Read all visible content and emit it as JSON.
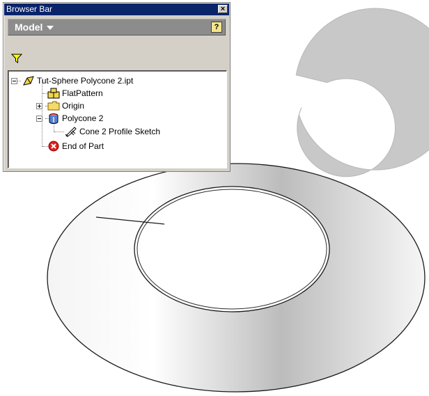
{
  "browser_bar": {
    "title": "Browser Bar",
    "close_glyph": "×",
    "model_label": "Model",
    "help_glyph": "?",
    "filter_icon": "funnel-filter-icon",
    "tree": [
      {
        "label": "Tut-Sphere Polycone 2.ipt",
        "icon": "part-document-icon",
        "expander": "minus"
      },
      {
        "label": "FlatPattern",
        "icon": "flat-pattern-icon"
      },
      {
        "label": "Origin",
        "icon": "folder-icon",
        "expander": "plus"
      },
      {
        "label": "Polycone 2",
        "icon": "polycone-feature-icon",
        "expander": "minus"
      },
      {
        "label": "Cone 2 Profile Sketch",
        "icon": "sketch-icon"
      },
      {
        "label": "End of Part",
        "icon": "end-of-part-icon"
      }
    ]
  },
  "graphics": {
    "flat_pattern_color": "#c8c8c8",
    "cone_edge_color": "#1a1a1a"
  }
}
